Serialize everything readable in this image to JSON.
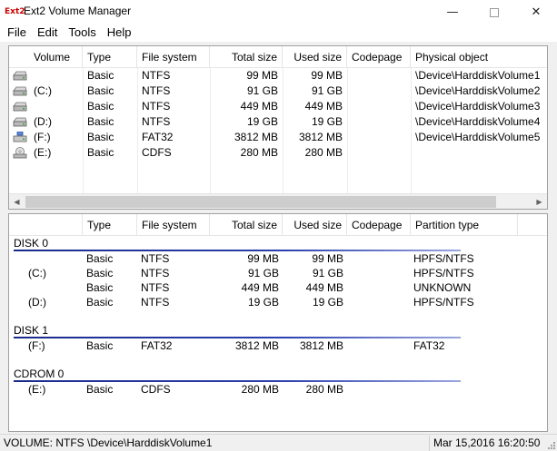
{
  "window": {
    "title": "Ext2 Volume Manager",
    "icon_label": "Ext2",
    "minimize_glyph": "—",
    "close_glyph": "✕"
  },
  "menu": [
    "File",
    "Edit",
    "Tools",
    "Help"
  ],
  "volumes": {
    "headers": [
      "Volume",
      "Type",
      "File system",
      "Total size",
      "Used size",
      "Codepage",
      "Physical object"
    ],
    "rows": [
      {
        "icon": "hard-drive-icon",
        "volume": "",
        "type": "Basic",
        "fs": "NTFS",
        "total": "99 MB",
        "used": "99 MB",
        "codepage": "",
        "physical": "\\Device\\HarddiskVolume1"
      },
      {
        "icon": "hard-drive-icon",
        "volume": "(C:)",
        "type": "Basic",
        "fs": "NTFS",
        "total": "91 GB",
        "used": "91 GB",
        "codepage": "",
        "physical": "\\Device\\HarddiskVolume2"
      },
      {
        "icon": "hard-drive-icon",
        "volume": "",
        "type": "Basic",
        "fs": "NTFS",
        "total": "449 MB",
        "used": "449 MB",
        "codepage": "",
        "physical": "\\Device\\HarddiskVolume3"
      },
      {
        "icon": "hard-drive-icon",
        "volume": "(D:)",
        "type": "Basic",
        "fs": "NTFS",
        "total": "19 GB",
        "used": "19 GB",
        "codepage": "",
        "physical": "\\Device\\HarddiskVolume4"
      },
      {
        "icon": "usb-drive-icon",
        "volume": "(F:)",
        "type": "Basic",
        "fs": "FAT32",
        "total": "3812 MB",
        "used": "3812 MB",
        "codepage": "",
        "physical": "\\Device\\HarddiskVolume5"
      },
      {
        "icon": "cdrom-icon",
        "volume": "(E:)",
        "type": "Basic",
        "fs": "CDFS",
        "total": "280 MB",
        "used": "280 MB",
        "codepage": "",
        "physical": ""
      }
    ]
  },
  "disks": {
    "headers": [
      "",
      "Type",
      "File system",
      "Total size",
      "Used size",
      "Codepage",
      "Partition type"
    ],
    "groups": [
      {
        "label": "DISK 0",
        "rows": [
          {
            "volume": "",
            "type": "Basic",
            "fs": "NTFS",
            "total": "99 MB",
            "used": "99 MB",
            "codepage": "",
            "ptype": "HPFS/NTFS"
          },
          {
            "volume": "(C:)",
            "type": "Basic",
            "fs": "NTFS",
            "total": "91 GB",
            "used": "91 GB",
            "codepage": "",
            "ptype": "HPFS/NTFS"
          },
          {
            "volume": "",
            "type": "Basic",
            "fs": "NTFS",
            "total": "449 MB",
            "used": "449 MB",
            "codepage": "",
            "ptype": "UNKNOWN"
          },
          {
            "volume": "(D:)",
            "type": "Basic",
            "fs": "NTFS",
            "total": "19 GB",
            "used": "19 GB",
            "codepage": "",
            "ptype": "HPFS/NTFS"
          }
        ]
      },
      {
        "label": "DISK 1",
        "rows": [
          {
            "volume": "(F:)",
            "type": "Basic",
            "fs": "FAT32",
            "total": "3812 MB",
            "used": "3812 MB",
            "codepage": "",
            "ptype": "FAT32"
          }
        ]
      },
      {
        "label": "CDROM 0",
        "rows": [
          {
            "volume": "(E:)",
            "type": "Basic",
            "fs": "CDFS",
            "total": "280 MB",
            "used": "280 MB",
            "codepage": "",
            "ptype": ""
          }
        ]
      }
    ]
  },
  "status": {
    "left": "VOLUME:  NTFS \\Device\\HarddiskVolume1",
    "right": "Mar 15,2016 16:20:50"
  },
  "colors": {
    "group_line": "#2b3fae",
    "panel_border": "#a0a0a0",
    "background": "#f0f0f0"
  }
}
